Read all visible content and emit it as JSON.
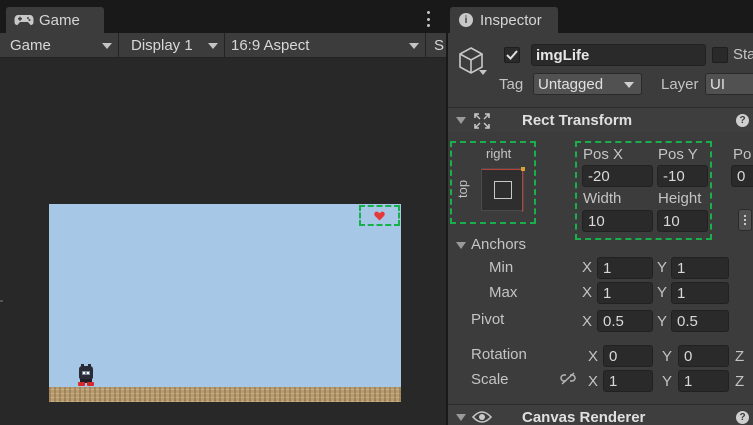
{
  "game": {
    "tab_label": "Game",
    "toolbar": {
      "view_mode": "Game",
      "display": "Display 1",
      "aspect": "16:9 Aspect",
      "scale_prefix": "S"
    }
  },
  "inspector": {
    "tab_label": "Inspector",
    "object": {
      "active": true,
      "name": "imgLife",
      "static_label": "Sta",
      "tag_label": "Tag",
      "tag_value": "Untagged",
      "layer_label": "Layer",
      "layer_value": "UI"
    },
    "rect_transform": {
      "title": "Rect Transform",
      "anchor_h": "right",
      "anchor_v": "top",
      "pos_x_label": "Pos X",
      "pos_y_label": "Pos Y",
      "pos_z_label": "Po",
      "pos_x": "-20",
      "pos_y": "-10",
      "pos_z": "0",
      "width_label": "Width",
      "height_label": "Height",
      "width": "10",
      "height": "10",
      "anchors_label": "Anchors",
      "min_label": "Min",
      "min_x": "1",
      "min_y": "1",
      "max_label": "Max",
      "max_x": "1",
      "max_y": "1",
      "pivot_label": "Pivot",
      "pivot_x": "0.5",
      "pivot_y": "0.5",
      "rotation_label": "Rotation",
      "rot_x": "0",
      "rot_y": "0",
      "rot_z_label": "Z",
      "scale_label": "Scale",
      "scale_x": "1",
      "scale_y": "1",
      "scale_z_label": "Z",
      "x_label": "X",
      "y_label": "Y"
    },
    "canvas_renderer": {
      "title": "Canvas Renderer"
    }
  },
  "colors": {
    "sky": "#a7c7e7",
    "ground": "#b79b70",
    "heart": "#e53a3a",
    "highlight": "#17b04a"
  }
}
